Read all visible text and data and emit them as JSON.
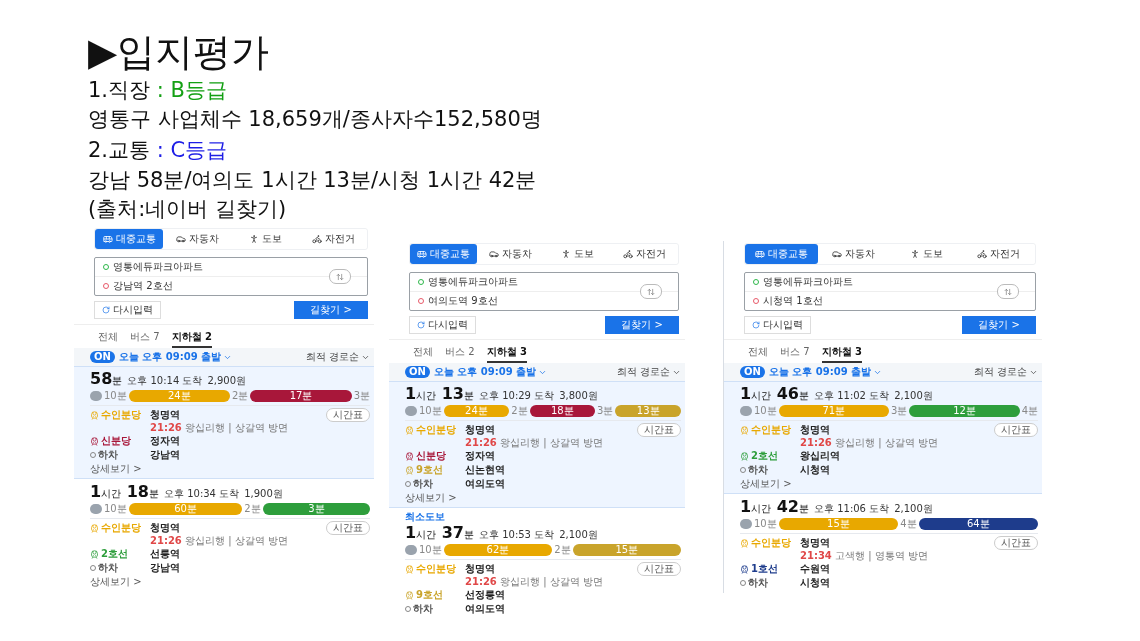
{
  "slide": {
    "title": "▶입지평가",
    "lines": [
      {
        "parts": [
          {
            "text": "1.직장 "
          },
          {
            "text": ": B등급",
            "color": "#14a014"
          }
        ]
      },
      {
        "parts": [
          {
            "text": "영통구 사업체수 18,659개/종사자수152,580명"
          }
        ]
      },
      {
        "parts": [
          {
            "text": "2.교통 "
          },
          {
            "text": ": C등급",
            "color": "#1e1ee6"
          }
        ]
      },
      {
        "parts": [
          {
            "text": "강남 58분/여의도 1시간 13분/시청 1시간 42분"
          }
        ]
      },
      {
        "parts": [
          {
            "text": "(출처:네이버 길찾기)"
          }
        ]
      }
    ]
  },
  "panels": [
    {
      "modes": [
        {
          "label": "대중교통",
          "kind": "bus",
          "selected": true
        },
        {
          "label": "자동차",
          "kind": "car",
          "selected": false
        },
        {
          "label": "도보",
          "kind": "walk",
          "selected": false
        },
        {
          "label": "자전거",
          "kind": "bike",
          "selected": false
        }
      ],
      "origin": "영통에듀파크아파트",
      "destination": "강남역 2호선",
      "reset": "다시입력",
      "search": "길찾기 >",
      "tabs": [
        {
          "label": "전체",
          "selected": false
        },
        {
          "label": "버스 7",
          "selected": false
        },
        {
          "label": "지하철 2",
          "selected": true
        }
      ],
      "toggle": "ON",
      "depart": "오늘 오후 09:09 출발",
      "sort": "최적 경로순",
      "routes": [
        {
          "selected": true,
          "duration": [
            {
              "value": "58",
              "unit": "분"
            }
          ],
          "arrival": "오후 10:14 도착",
          "fare": "2,900원",
          "segments": [
            {
              "kind": "walk",
              "label": "10분"
            },
            {
              "kind": "ride",
              "label": "24분",
              "color": "#e8a800"
            },
            {
              "kind": "gap",
              "label": "2분"
            },
            {
              "kind": "ride",
              "label": "17분",
              "color": "#a8173a"
            },
            {
              "kind": "gap",
              "label": "3분"
            }
          ],
          "steps": [
            {
              "kind": "ride",
              "line": "수인분당",
              "color": "#e8a800",
              "station": "청명역",
              "time": "21:26",
              "detail": "왕십리행 | 상갈역 방면",
              "timetable": "시간표"
            },
            {
              "kind": "ride",
              "line": "신분당",
              "color": "#a8173a",
              "station": "정자역"
            },
            {
              "kind": "alight",
              "line": "하차",
              "station": "강남역"
            }
          ],
          "more": "상세보기 >"
        },
        {
          "selected": false,
          "duration": [
            {
              "value": "1",
              "unit": "시간"
            },
            {
              "value": "18",
              "unit": "분"
            }
          ],
          "arrival": "오후 10:34 도착",
          "fare": "1,900원",
          "segments": [
            {
              "kind": "walk",
              "label": "10분"
            },
            {
              "kind": "ride",
              "label": "60분",
              "color": "#e8a800"
            },
            {
              "kind": "gap",
              "label": "2분"
            },
            {
              "kind": "ride",
              "label": "3분",
              "color": "#2e9e3c"
            }
          ],
          "steps": [
            {
              "kind": "ride",
              "line": "수인분당",
              "color": "#e8a800",
              "station": "청명역",
              "time": "21:26",
              "detail": "왕십리행 | 상갈역 방면",
              "timetable": "시간표"
            },
            {
              "kind": "ride",
              "line": "2호선",
              "color": "#2e9e3c",
              "station": "선릉역"
            },
            {
              "kind": "alight",
              "line": "하차",
              "station": "강남역"
            }
          ],
          "more": "상세보기 >"
        }
      ]
    },
    {
      "modes": [
        {
          "label": "대중교통",
          "kind": "bus",
          "selected": true
        },
        {
          "label": "자동차",
          "kind": "car",
          "selected": false
        },
        {
          "label": "도보",
          "kind": "walk",
          "selected": false
        },
        {
          "label": "자전거",
          "kind": "bike",
          "selected": false
        }
      ],
      "origin": "영통에듀파크아파트",
      "destination": "여의도역 9호선",
      "reset": "다시입력",
      "search": "길찾기 >",
      "tabs": [
        {
          "label": "전체",
          "selected": false
        },
        {
          "label": "버스 2",
          "selected": false
        },
        {
          "label": "지하철 3",
          "selected": true
        }
      ],
      "toggle": "ON",
      "depart": "오늘 오후 09:09 출발",
      "sort": "최적 경로순",
      "routes": [
        {
          "selected": true,
          "duration": [
            {
              "value": "1",
              "unit": "시간"
            },
            {
              "value": "13",
              "unit": "분"
            }
          ],
          "arrival": "오후 10:29 도착",
          "fare": "3,800원",
          "segments": [
            {
              "kind": "walk",
              "label": "10분"
            },
            {
              "kind": "ride",
              "label": "24분",
              "color": "#e8a800"
            },
            {
              "kind": "gap",
              "label": "2분"
            },
            {
              "kind": "ride",
              "label": "18분",
              "color": "#a8173a"
            },
            {
              "kind": "gap",
              "label": "3분"
            },
            {
              "kind": "ride",
              "label": "13분",
              "color": "#c9a42b"
            }
          ],
          "steps": [
            {
              "kind": "ride",
              "line": "수인분당",
              "color": "#e8a800",
              "station": "청명역",
              "time": "21:26",
              "detail": "왕십리행 | 상갈역 방면",
              "timetable": "시간표"
            },
            {
              "kind": "ride",
              "line": "신분당",
              "color": "#a8173a",
              "station": "정자역"
            },
            {
              "kind": "ride",
              "line": "9호선",
              "color": "#c9a42b",
              "station": "신논현역"
            },
            {
              "kind": "alight",
              "line": "하차",
              "station": "여의도역"
            }
          ],
          "more": "상세보기 >"
        },
        {
          "selected": false,
          "badge": "최소도보",
          "duration": [
            {
              "value": "1",
              "unit": "시간"
            },
            {
              "value": "37",
              "unit": "분"
            }
          ],
          "arrival": "오후 10:53 도착",
          "fare": "2,100원",
          "segments": [
            {
              "kind": "walk",
              "label": "10분"
            },
            {
              "kind": "ride",
              "label": "62분",
              "color": "#e8a800"
            },
            {
              "kind": "gap",
              "label": "2분"
            },
            {
              "kind": "ride",
              "label": "15분",
              "color": "#c9a42b"
            }
          ],
          "steps": [
            {
              "kind": "ride",
              "line": "수인분당",
              "color": "#e8a800",
              "station": "청명역",
              "time": "21:26",
              "detail": "왕십리행 | 상갈역 방면",
              "timetable": "시간표"
            },
            {
              "kind": "ride",
              "line": "9호선",
              "color": "#c9a42b",
              "station": "선정릉역"
            },
            {
              "kind": "alight",
              "line": "하차",
              "station": "여의도역"
            }
          ]
        }
      ]
    },
    {
      "modes": [
        {
          "label": "대중교통",
          "kind": "bus",
          "selected": true
        },
        {
          "label": "자동차",
          "kind": "car",
          "selected": false
        },
        {
          "label": "도보",
          "kind": "walk",
          "selected": false
        },
        {
          "label": "자전거",
          "kind": "bike",
          "selected": false
        }
      ],
      "origin": "영통에듀파크아파트",
      "destination": "시청역 1호선",
      "reset": "다시입력",
      "search": "길찾기 >",
      "tabs": [
        {
          "label": "전체",
          "selected": false
        },
        {
          "label": "버스 7",
          "selected": false
        },
        {
          "label": "지하철 3",
          "selected": true
        }
      ],
      "toggle": "ON",
      "depart": "오늘 오후 09:09 출발",
      "sort": "최적 경로순",
      "routes": [
        {
          "selected": true,
          "duration": [
            {
              "value": "1",
              "unit": "시간"
            },
            {
              "value": "46",
              "unit": "분"
            }
          ],
          "arrival": "오후 11:02 도착",
          "fare": "2,100원",
          "segments": [
            {
              "kind": "walk",
              "label": "10분"
            },
            {
              "kind": "ride",
              "label": "71분",
              "color": "#e8a800"
            },
            {
              "kind": "gap",
              "label": "3분"
            },
            {
              "kind": "ride",
              "label": "12분",
              "color": "#2e9e3c"
            },
            {
              "kind": "gap",
              "label": "4분"
            }
          ],
          "steps": [
            {
              "kind": "ride",
              "line": "수인분당",
              "color": "#e8a800",
              "station": "청명역",
              "time": "21:26",
              "detail": "왕십리행 | 상갈역 방면",
              "timetable": "시간표"
            },
            {
              "kind": "ride",
              "line": "2호선",
              "color": "#2e9e3c",
              "station": "왕십리역"
            },
            {
              "kind": "alight",
              "line": "하차",
              "station": "시청역"
            }
          ],
          "more": "상세보기 >"
        },
        {
          "selected": false,
          "duration": [
            {
              "value": "1",
              "unit": "시간"
            },
            {
              "value": "42",
              "unit": "분"
            }
          ],
          "arrival": "오후 11:06 도착",
          "fare": "2,100원",
          "segments": [
            {
              "kind": "walk",
              "label": "10분"
            },
            {
              "kind": "ride",
              "label": "15분",
              "color": "#e8a800"
            },
            {
              "kind": "gap",
              "label": "4분"
            },
            {
              "kind": "ride",
              "label": "64분",
              "color": "#1e3c8c"
            }
          ],
          "steps": [
            {
              "kind": "ride",
              "line": "수인분당",
              "color": "#e8a800",
              "station": "청명역",
              "time": "21:34",
              "detail": "고색행 | 영통역 방면",
              "timetable": "시간표"
            },
            {
              "kind": "ride",
              "line": "1호선",
              "color": "#1e3c8c",
              "station": "수원역"
            },
            {
              "kind": "alight",
              "line": "하차",
              "station": "시청역"
            }
          ]
        }
      ]
    }
  ]
}
